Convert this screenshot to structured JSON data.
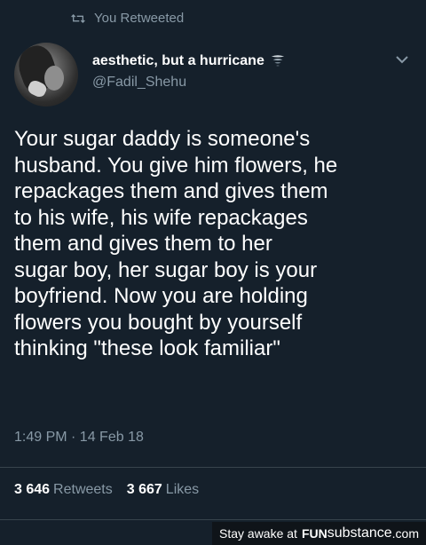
{
  "retweet": {
    "label": "You Retweeted",
    "icon": "retweet-icon"
  },
  "author": {
    "display_name": "aesthetic, but a hurricane",
    "name_emoji": "tornado-icon",
    "handle": "@Fadil_Shehu"
  },
  "tweet": {
    "text": "Your sugar daddy is someone's\nhusband. You give him flowers, he\nrepackages them and gives them\nto his wife, his wife repackages\nthem and gives them to her\nsugar boy, her sugar boy is your\nboyfriend. Now you are holding\nflowers you bought by yourself\nthinking \"these look familiar\"",
    "timestamp": "1:49 PM · 14 Feb 18"
  },
  "stats": {
    "retweets_count": "3 646",
    "retweets_label": "Retweets",
    "likes_count": "3 667",
    "likes_label": "Likes"
  },
  "watermark": {
    "prefix": "Stay awake at",
    "brand_bold": "FUN",
    "brand_rest": "substance",
    "brand_suffix": ".com"
  },
  "colors": {
    "background": "#15202b",
    "secondary_text": "#8899a6",
    "divider": "#38444d"
  }
}
